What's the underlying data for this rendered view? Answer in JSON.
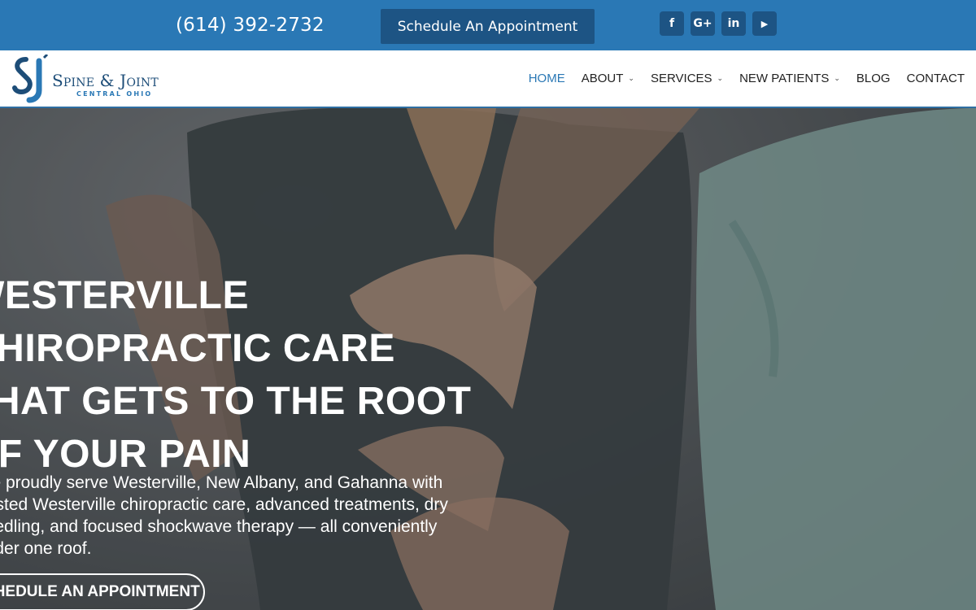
{
  "topbar": {
    "phone": "(614) 392-2732",
    "appointment_button": "Schedule An Appointment",
    "socials": [
      {
        "label": "f",
        "icon": "facebook-icon"
      },
      {
        "label": "G+",
        "icon": "google-plus-icon"
      },
      {
        "label": "in",
        "icon": "linkedin-icon"
      },
      {
        "label": "▶",
        "icon": "youtube-icon"
      }
    ]
  },
  "header": {
    "logo_text": "Spine & Joint",
    "logo_subtext": "CENTRAL OHIO",
    "nav": [
      {
        "label": "HOME",
        "has_dropdown": false,
        "active": true
      },
      {
        "label": "ABOUT",
        "has_dropdown": true
      },
      {
        "label": "SERVICES",
        "has_dropdown": true
      },
      {
        "label": "NEW PATIENTS",
        "has_dropdown": true
      },
      {
        "label": "BLOG",
        "has_dropdown": false
      },
      {
        "label": "CONTACT",
        "has_dropdown": false
      }
    ]
  },
  "hero": {
    "title_lines": [
      "WESTERVILLE",
      "CHIROPRACTIC CARE",
      "THAT GETS TO THE ROOT",
      "OF YOUR PAIN"
    ],
    "text_lines": [
      "We proudly serve Westerville, New Albany, and Gahanna with",
      "trusted Westerville chiropractic care, advanced treatments, dry",
      "needling, and focused shockwave therapy — all conveniently",
      "under one roof."
    ],
    "cta": "SCHEDULE AN APPOINTMENT"
  },
  "colors": {
    "topbar": "#2a78b5",
    "button": "#1d5484",
    "nav_active": "#2a78b5"
  }
}
